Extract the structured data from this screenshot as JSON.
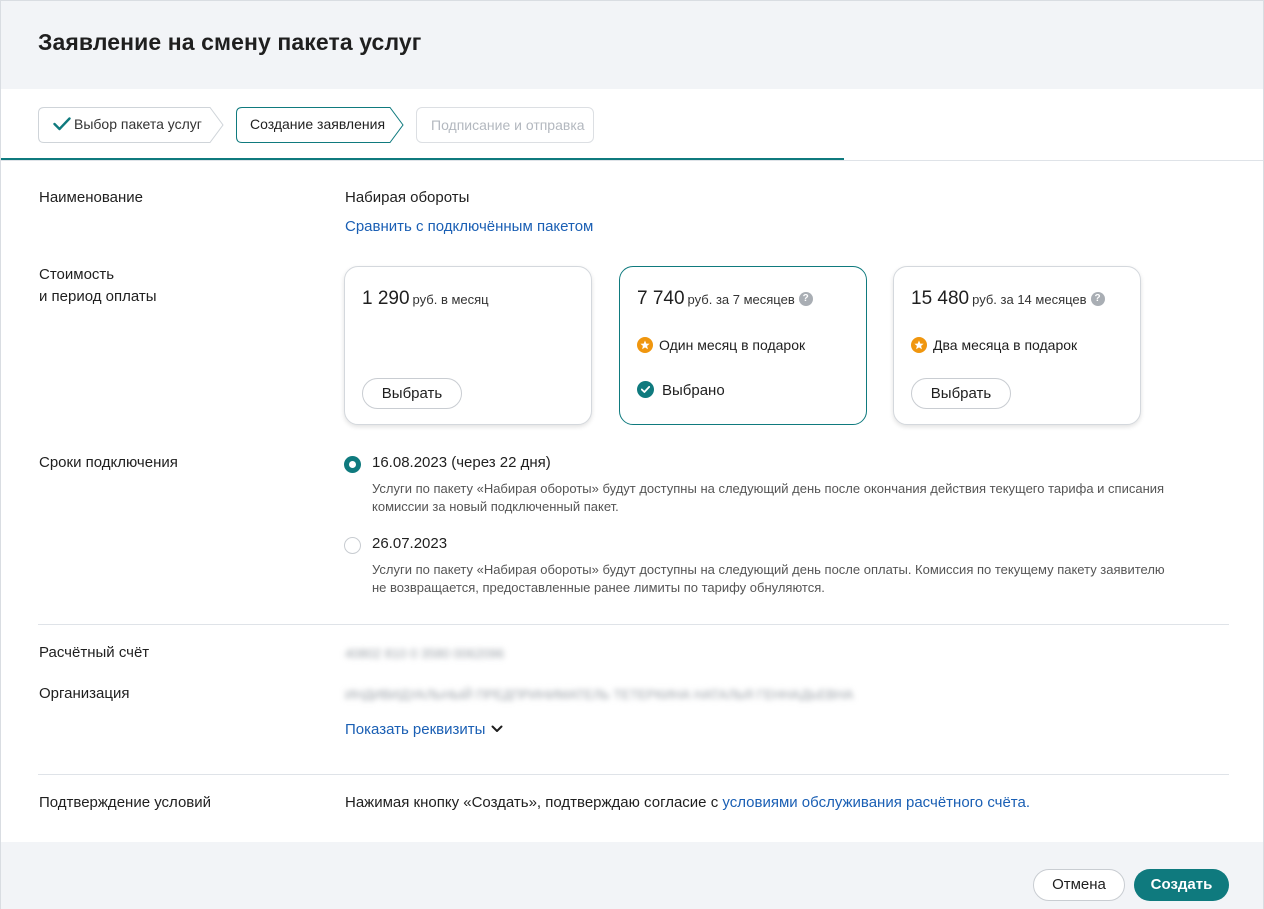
{
  "header": {
    "title": "Заявление на смену пакета услуг"
  },
  "stepper": {
    "steps": [
      {
        "label": "Выбор пакета услуг",
        "state": "done"
      },
      {
        "label": "Создание заявления",
        "state": "active"
      },
      {
        "label": "Подписание и отправка",
        "state": "pending"
      }
    ]
  },
  "name_section": {
    "label": "Наименование",
    "value": "Набирая обороты",
    "compare_link": "Сравнить с подключённым пакетом"
  },
  "cost_section": {
    "label_line1": "Стоимость",
    "label_line2": "и период оплаты",
    "cards": [
      {
        "price": "1 290",
        "period": "руб. в месяц",
        "gift": "",
        "button": "Выбрать",
        "selected": false
      },
      {
        "price": "7 740",
        "period": "руб. за 7 месяцев",
        "gift": "Один месяц в подарок",
        "selected_label": "Выбрано",
        "selected": true
      },
      {
        "price": "15 480",
        "period": "руб. за 14 месяцев",
        "gift": "Два месяца в подарок",
        "button": "Выбрать",
        "selected": false
      }
    ],
    "help_glyph": "?"
  },
  "terms_section": {
    "label": "Сроки подключения",
    "options": [
      {
        "title": "16.08.2023 (через 22 дня)",
        "desc_line1": "Услуги по пакету «Набирая обороты» будут доступны на следующий день после окончания действия текущего тарифа и списания",
        "desc_line2": "комиссии за новый подключенный пакет.",
        "checked": true
      },
      {
        "title": "26.07.2023",
        "desc_line1": "Услуги по пакету «Набирая обороты» будут доступны на следующий день после оплаты. Комиссия по текущему пакету заявителю",
        "desc_line2": "не возвращается, предоставленные ранее лимиты по тарифу обнуляются.",
        "checked": false
      }
    ]
  },
  "account_section": {
    "account_label": "Расчётный счёт",
    "account_value": "40802 810 0 3580 0062096",
    "org_label": "Организация",
    "org_value": "ИНДИВИДУАЛЬНЫЙ ПРЕДПРИНИМАТЕЛЬ ТЕТЕРКИНА НАТАЛЬЯ ГЕННАДЬЕВНА",
    "show_details_link": "Показать реквизиты"
  },
  "confirm_section": {
    "label": "Подтверждение условий",
    "text": "Нажимая кнопку «Создать», подтверждаю согласие с",
    "link": "условиями обслуживания расчётного счёта."
  },
  "footer": {
    "cancel_label": "Отмена",
    "create_label": "Создать"
  },
  "colors": {
    "accent": "#0f7a7e",
    "link": "#1a5fb4",
    "gift": "#f0960e",
    "header_bg": "#f2f4f7"
  }
}
